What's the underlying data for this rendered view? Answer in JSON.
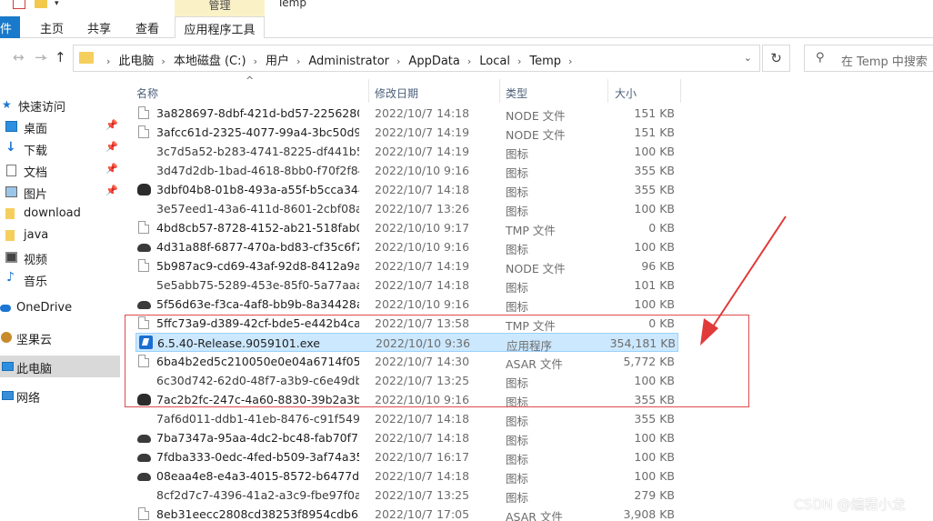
{
  "ribbon": {
    "manage_label": "管理",
    "window_title": "Temp",
    "tabs": {
      "file": "件",
      "home": "主页",
      "share": "共享",
      "view": "查看",
      "app_tools": "应用程序工具"
    }
  },
  "address": {
    "crumbs": [
      "此电脑",
      "本地磁盘 (C:)",
      "用户",
      "Administrator",
      "AppData",
      "Local",
      "Temp"
    ],
    "search_placeholder": "在 Temp 中搜索"
  },
  "sidebar": {
    "items": [
      {
        "label": "快速访问",
        "icon": "star-icon",
        "pinned": false
      },
      {
        "label": "桌面",
        "icon": "desktop-icon",
        "pinned": true
      },
      {
        "label": "下载",
        "icon": "download-icon",
        "pinned": true
      },
      {
        "label": "文档",
        "icon": "document-icon",
        "pinned": true
      },
      {
        "label": "图片",
        "icon": "picture-icon",
        "pinned": true
      },
      {
        "label": "download",
        "icon": "folder-icon",
        "pinned": false
      },
      {
        "label": "java",
        "icon": "folder-icon",
        "pinned": false
      },
      {
        "label": "视频",
        "icon": "video-icon",
        "pinned": false
      },
      {
        "label": "音乐",
        "icon": "music-icon",
        "pinned": false
      },
      {
        "label": "OneDrive",
        "icon": "cloud-icon",
        "pinned": false
      },
      {
        "label": "坚果云",
        "icon": "nutstore-icon",
        "pinned": false
      },
      {
        "label": "此电脑",
        "icon": "computer-icon",
        "pinned": false,
        "selected": true
      },
      {
        "label": "网络",
        "icon": "network-icon",
        "pinned": false
      }
    ]
  },
  "columns": {
    "name": "名称",
    "date": "修改日期",
    "type": "类型",
    "size": "大小"
  },
  "files": [
    {
      "name": "3a828697-8dbf-421d-bd57-2256280...",
      "date": "2022/10/7 14:18",
      "type": "NODE 文件",
      "size": "151 KB",
      "icon": "file-icon"
    },
    {
      "name": "3afcc61d-2325-4077-99a4-3bc50d94...",
      "date": "2022/10/7 14:19",
      "type": "NODE 文件",
      "size": "151 KB",
      "icon": "file-icon"
    },
    {
      "name": "3c7d5a52-b283-4741-8225-df441b51...",
      "date": "2022/10/7 14:19",
      "type": "图标",
      "size": "100 KB",
      "icon": "blank-icon"
    },
    {
      "name": "3d47d2db-1bad-4618-8bb0-f70f2f84...",
      "date": "2022/10/10 9:16",
      "type": "图标",
      "size": "355 KB",
      "icon": "blank-icon"
    },
    {
      "name": "3dbf04b8-01b8-493a-a55f-b5cca344...",
      "date": "2022/10/7 14:18",
      "type": "图标",
      "size": "355 KB",
      "icon": "cloud-check-icon"
    },
    {
      "name": "3e57eed1-43a6-411d-8601-2cbf08a4...",
      "date": "2022/10/7 13:26",
      "type": "图标",
      "size": "100 KB",
      "icon": "blank-icon"
    },
    {
      "name": "4bd8cb57-8728-4152-ab21-518fab0f...",
      "date": "2022/10/10 9:17",
      "type": "TMP 文件",
      "size": "0 KB",
      "icon": "file-icon"
    },
    {
      "name": "4d31a88f-6877-470a-bd83-cf35c6f79...",
      "date": "2022/10/10 9:16",
      "type": "图标",
      "size": "100 KB",
      "icon": "cloud-icon"
    },
    {
      "name": "5b987ac9-cd69-43af-92d8-8412a9a4...",
      "date": "2022/10/7 14:19",
      "type": "NODE 文件",
      "size": "96 KB",
      "icon": "file-icon"
    },
    {
      "name": "5e5abb75-5289-453e-85f0-5a77aaaa...",
      "date": "2022/10/7 14:18",
      "type": "图标",
      "size": "101 KB",
      "icon": "blank-icon"
    },
    {
      "name": "5f56d63e-f3ca-4af8-bb9b-8a34428a6...",
      "date": "2022/10/10 9:16",
      "type": "图标",
      "size": "100 KB",
      "icon": "cloud-icon"
    },
    {
      "name": "5ffc73a9-d389-42cf-bde5-e442b4ca5...",
      "date": "2022/10/7 13:58",
      "type": "TMP 文件",
      "size": "0 KB",
      "icon": "file-icon"
    },
    {
      "name": "6.5.40-Release.9059101.exe",
      "date": "2022/10/10 9:36",
      "type": "应用程序",
      "size": "354,181 KB",
      "icon": "app-icon",
      "selected": true
    },
    {
      "name": "6ba4b2ed5c210050e0e04a6714f053e...",
      "date": "2022/10/7 14:30",
      "type": "ASAR 文件",
      "size": "5,772 KB",
      "icon": "file-icon"
    },
    {
      "name": "6c30d742-62d0-48f7-a3b9-c6e49db7...",
      "date": "2022/10/7 13:25",
      "type": "图标",
      "size": "100 KB",
      "icon": "blank-icon"
    },
    {
      "name": "7ac2b2fc-247c-4a60-8830-39b2a3b6...",
      "date": "2022/10/10 9:16",
      "type": "图标",
      "size": "355 KB",
      "icon": "cloud-check-icon"
    },
    {
      "name": "7af6d011-ddb1-41eb-8476-c91f5498...",
      "date": "2022/10/7 14:18",
      "type": "图标",
      "size": "355 KB",
      "icon": "blank-icon"
    },
    {
      "name": "7ba7347a-95aa-4dc2-bc48-fab70f79...",
      "date": "2022/10/7 14:18",
      "type": "图标",
      "size": "100 KB",
      "icon": "cloud-icon"
    },
    {
      "name": "7fdba333-0edc-4fed-b509-3af74a35...",
      "date": "2022/10/7 16:17",
      "type": "图标",
      "size": "100 KB",
      "icon": "cloud-icon"
    },
    {
      "name": "08eaa4e8-e4a3-4015-8572-b6477db...",
      "date": "2022/10/7 14:18",
      "type": "图标",
      "size": "100 KB",
      "icon": "cloud-icon"
    },
    {
      "name": "8cf2d7c7-4396-41a2-a3c9-fbe97f0a3...",
      "date": "2022/10/7 13:25",
      "type": "图标",
      "size": "279 KB",
      "icon": "blank-icon"
    },
    {
      "name": "8eb31eecc2808cd38253f8954cdb652...",
      "date": "2022/10/7 17:05",
      "type": "ASAR 文件",
      "size": "3,908 KB",
      "icon": "file-icon"
    }
  ],
  "annotation": {
    "box_color": "#e04b4b",
    "arrow_color": "#e03a3a"
  },
  "watermark": "CSDN @编程小龙"
}
